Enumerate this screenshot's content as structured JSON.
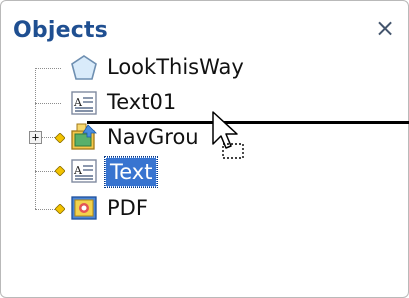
{
  "panel": {
    "title": "Objects",
    "close_glyph": "×"
  },
  "tree": {
    "items": [
      {
        "label": "LookThisWay",
        "icon": "pentagon-shape-icon",
        "selected": false
      },
      {
        "label": "Text01",
        "icon": "text-object-icon",
        "selected": false
      },
      {
        "label": "NavGrou",
        "icon": "nav-group-icon",
        "selected": false,
        "expandable": true,
        "expander_glyph": "+"
      },
      {
        "label": "Text",
        "icon": "text-object-icon",
        "selected": true
      },
      {
        "label": "PDF",
        "icon": "pdf-object-icon",
        "selected": false
      }
    ]
  },
  "colors": {
    "title": "#1f4f91",
    "selection": "#3874d0",
    "connector_dot": "#f0c000",
    "drop_line": "#000000"
  }
}
